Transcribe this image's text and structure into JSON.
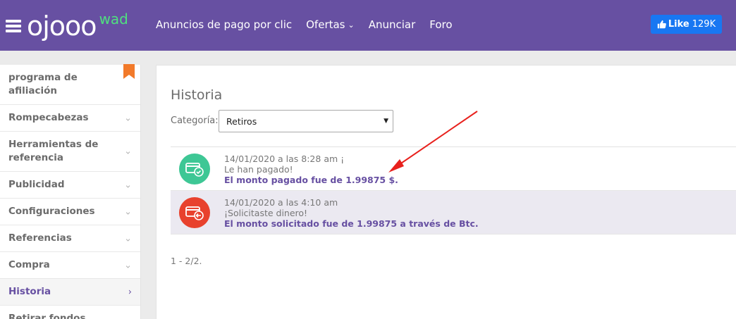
{
  "header": {
    "logo_main": "ojooo",
    "logo_sup": "wad",
    "nav": [
      {
        "label": "Anuncios de pago por clic",
        "has_dropdown": false
      },
      {
        "label": "Ofertas",
        "has_dropdown": true
      },
      {
        "label": "Anunciar",
        "has_dropdown": false
      },
      {
        "label": "Foro",
        "has_dropdown": false
      }
    ],
    "like_label": "Like",
    "like_count": "129K"
  },
  "sidebar": {
    "items": [
      {
        "label": "programa de afiliación",
        "active": false,
        "bookmark": true
      },
      {
        "label": "Rompecabezas",
        "active": false
      },
      {
        "label": "Herramientas de referencia",
        "active": false
      },
      {
        "label": "Publicidad",
        "active": false
      },
      {
        "label": "Configuraciones",
        "active": false
      },
      {
        "label": "Referencias",
        "active": false
      },
      {
        "label": "Compra",
        "active": false
      },
      {
        "label": "Historia",
        "active": true
      },
      {
        "label": "Retirar fondos",
        "active": false
      }
    ]
  },
  "main": {
    "title": "Historia",
    "category_label": "Categoría:",
    "category_value": "Retiros",
    "entries": [
      {
        "status": "paid",
        "date": "14/01/2020 a las 8:28 am ¡",
        "message": "Le han pagado!",
        "detail": "El monto pagado fue de 1.99875 $."
      },
      {
        "status": "requested",
        "date": "14/01/2020 a las 4:10 am",
        "message": "¡Solicitaste dinero!",
        "detail": "El monto solicitado fue de 1.99875 a través de Btc."
      }
    ],
    "pagination": "1 - 2/2."
  },
  "colors": {
    "header_bg": "#6750a2",
    "logo_accent": "#4fe07f",
    "like_blue": "#1877f2",
    "paid_green": "#3ec795",
    "requested_red": "#e8412d",
    "annotation_arrow": "#e8211d"
  }
}
